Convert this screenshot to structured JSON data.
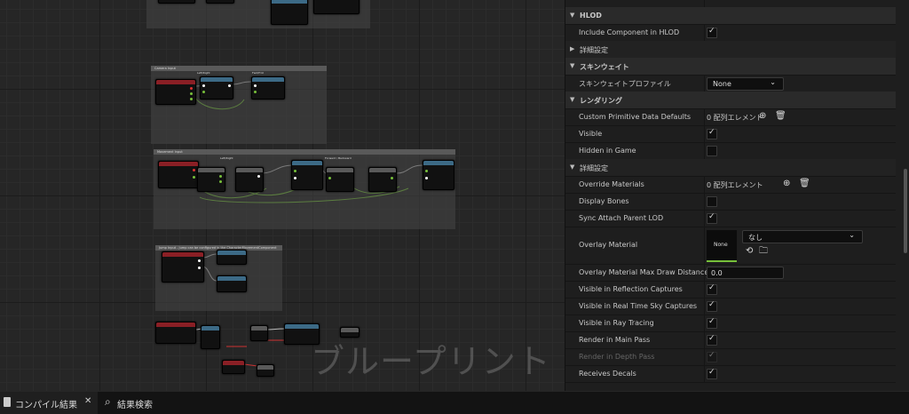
{
  "graph": {
    "comments": {
      "camera": "Camera Input",
      "movement": "Movement Input",
      "jump": "Jump Input - Jump can be configured in the CharacterMovementComponent"
    },
    "labels": {
      "left_right": "Left/Right",
      "for_fwd": "Fwd/Frnt",
      "forward_backward": "Forward / Backward"
    },
    "watermark": "ブループリント"
  },
  "details": {
    "sections": {
      "hlod": "HLOD",
      "hlod_advanced": "詳細設定",
      "skin_weight": "スキンウェイト",
      "rendering": "レンダリング",
      "rendering_advanced": "詳細設定"
    },
    "props": {
      "include_component_in_hlod": "Include Component in HLOD",
      "skin_weight_profile": "スキンウェイトプロファイル",
      "skin_weight_profile_value": "None",
      "custom_primitive_data_defaults": "Custom Primitive Data Defaults",
      "custom_primitive_data_defaults_value": "0 配列エレメント",
      "visible": "Visible",
      "hidden_in_game": "Hidden in Game",
      "override_materials": "Override Materials",
      "override_materials_value": "0 配列エレメント",
      "display_bones": "Display Bones",
      "sync_attach_parent_lod": "Sync Attach Parent LOD",
      "overlay_material": "Overlay Material",
      "overlay_material_thumb": "None",
      "overlay_material_value": "なし",
      "overlay_material_max_draw_distance": "Overlay Material Max Draw Distance",
      "overlay_material_max_draw_distance_value": "0.0",
      "visible_in_reflection_captures": "Visible in Reflection Captures",
      "visible_in_real_time_sky_captures": "Visible in Real Time Sky Captures",
      "visible_in_ray_tracing": "Visible in Ray Tracing",
      "render_in_main_pass": "Render in Main Pass",
      "render_in_depth_pass": "Render in Depth Pass",
      "receives_decals": "Receives Decals"
    }
  },
  "bottom": {
    "compile_results": "コンパイル結果",
    "find_results": "結果検索"
  },
  "colors": {
    "accent_green": "#77c03a",
    "event_red": "#8a1f25",
    "function_blue": "#3c6a86"
  }
}
